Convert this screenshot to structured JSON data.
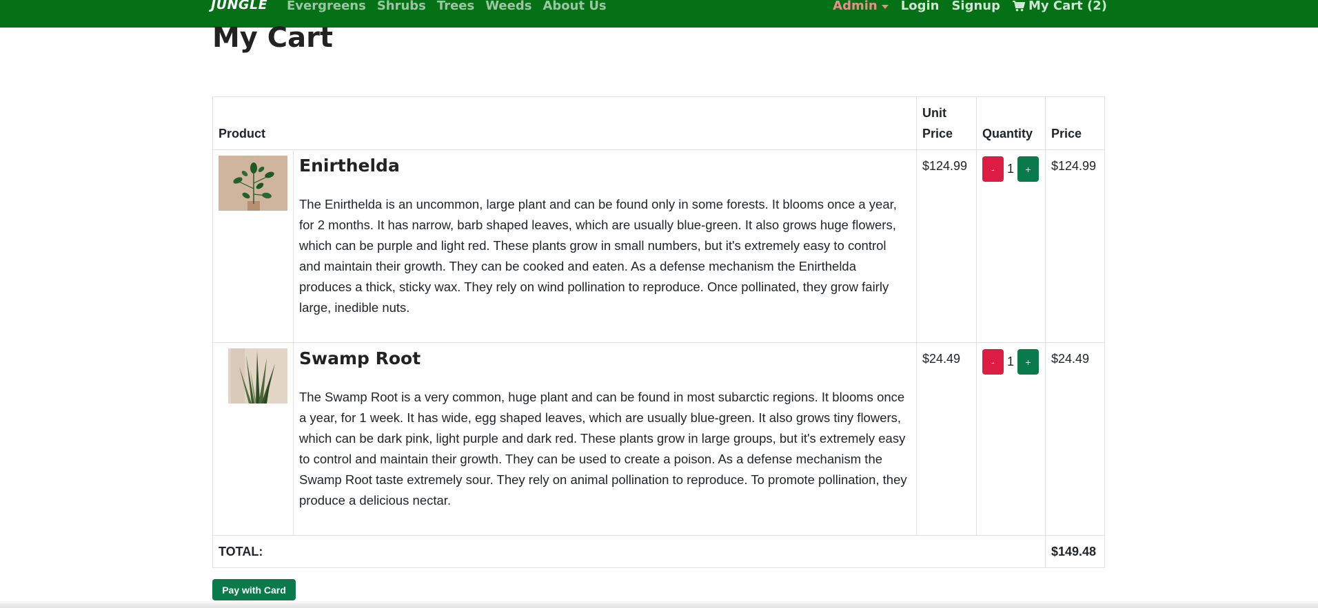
{
  "nav": {
    "brand": "JUNGLE",
    "links": [
      "Evergreens",
      "Shrubs",
      "Trees",
      "Weeds",
      "About Us"
    ],
    "admin": "Admin",
    "login": "Login",
    "signup": "Signup",
    "cart": "My Cart (2)"
  },
  "page": {
    "title": "My Cart"
  },
  "table": {
    "headers": {
      "product": "Product",
      "unit_price": "Unit Price",
      "quantity": "Quantity",
      "price": "Price"
    },
    "items": [
      {
        "name": "Enirthelda",
        "description": "The Enirthelda is an uncommon, large plant and can be found only in some forests. It blooms once a year, for 2 months. It has narrow, barb shaped leaves, which are usually blue-green. It also grows huge flowers, which can be purple and light red. These plants grow in small numbers, but it's extremely easy to control and maintain their growth. They can be cooked and eaten. As a defense mechanism the Enirthelda produces a thick, sticky wax. They rely on wind pollination to reproduce. Once pollinated, they grow fairly large, inedible nuts.",
        "unit_price": "$124.99",
        "quantity": "1",
        "price": "$124.99",
        "minus": "-",
        "plus": "+"
      },
      {
        "name": "Swamp Root",
        "description": "The Swamp Root is a very common, huge plant and can be found in most subarctic regions. It blooms once a year, for 1 week. It has wide, egg shaped leaves, which are usually blue-green. It also grows tiny flowers, which can be dark pink, light purple and dark red. These plants grow in large groups, but it's extremely easy to control and maintain their growth. They can be used to create a poison. As a defense mechanism the Swamp Root taste extremely sour. They rely on animal pollination to reproduce. To promote pollination, they produce a delicious nectar.",
        "unit_price": "$24.49",
        "quantity": "1",
        "price": "$24.49",
        "minus": "-",
        "plus": "+"
      }
    ],
    "total_label": "TOTAL:",
    "total_value": "$149.48"
  },
  "pay_button": "Pay with Card",
  "colors": {
    "navbar": "#057116",
    "minus_button": "#dc1c43",
    "plus_button": "#0a7a4b",
    "admin": "#f18b8b"
  }
}
